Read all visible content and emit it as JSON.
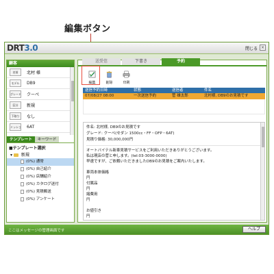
{
  "callout": {
    "label": "編集ボタン"
  },
  "window": {
    "logo_text": "DRT",
    "logo_version": "3.0",
    "close_label": "閉じる",
    "close_x": "×"
  },
  "customer_panel": {
    "header": "顧客",
    "rows": [
      {
        "key": "名前",
        "value": "北村 様"
      },
      {
        "key": "モデル",
        "value": "DB9"
      },
      {
        "key": "グレード",
        "value": "クーペ"
      },
      {
        "key": "区分",
        "value": "新規"
      },
      {
        "key": "下取り",
        "value": "なし"
      },
      {
        "key": "ミッション",
        "value": "6AT"
      }
    ]
  },
  "template_panel": {
    "tabs": [
      "テンプレート",
      "キーワード"
    ],
    "title": "■テンプレート選択",
    "root_folder": "新規",
    "items": [
      "(0%) 通常",
      "(0%) 自己紹介",
      "(0%) 店舗紹介",
      "(0%) カタログ送付",
      "(0%) 見積郵送",
      "(0%) アンケート"
    ]
  },
  "main_panel": {
    "tabs": [
      "送受信",
      "下書き",
      "予約"
    ],
    "toolbar": {
      "edit_label": "編集",
      "delete_label": "削除",
      "print_label": "印刷"
    },
    "table": {
      "headers": [
        "送信予約日時",
        "状態",
        "送信者",
        "件名"
      ],
      "row": [
        "07/08/27 08:00",
        "一次送信予約",
        "菅 雄太郎",
        "北村様, DB9のお見積です"
      ]
    },
    "preview": {
      "subject": "件名: 北村様, DB9のお見積です",
      "grade": "グレード: クーペ(セダン 1500cc・FF・OFP・6AT)",
      "price": "見積り価格: 30,000,000円",
      "lines": [
        "オートバイテル新車見積サービスをご利用いただきありがとうございます。",
        "私は現店の菅と申します。(tel:03-3000-0000)",
        "早速ですが、ご依頼いただきましたDB9のお見積をご案内いたします。",
        "",
        "車両本体価格",
        "円",
        "付属品",
        "円",
        "諸費用",
        "円",
        "",
        "お値引き",
        "円"
      ]
    }
  },
  "status_bar": {
    "message": "ここはメッセージの管理画面です",
    "help_label": "ヘルプ"
  }
}
